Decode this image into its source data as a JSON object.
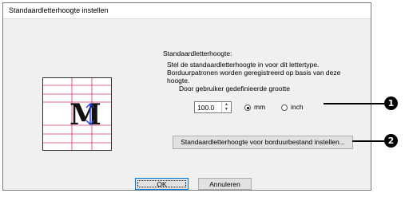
{
  "window": {
    "title": "Standaardletterhoogte instellen"
  },
  "section": {
    "heading": "Standaardletterhoogte:",
    "description_lines": [
      "Stel de standaardletterhoogte in voor dit lettertype.",
      "Borduurpatronen worden geregistreerd op basis van deze",
      "hoogte."
    ],
    "custom_size_label": "Door gebruiker gedefinieerde grootte"
  },
  "preview": {
    "letter": "M"
  },
  "size": {
    "value": "100.0",
    "unit_options": [
      {
        "label": "mm",
        "selected": true
      },
      {
        "label": "inch",
        "selected": false
      }
    ]
  },
  "buttons": {
    "embroidery_file": "Standaardletterhoogte voor borduurbestand instellen...",
    "ok": "OK",
    "cancel": "Annuleren"
  },
  "callouts": {
    "marker1": "1",
    "marker2": "2"
  },
  "colors": {
    "guide_lines": "#d2357a",
    "arrow": "#1a3fd6",
    "letter": "#111111"
  }
}
